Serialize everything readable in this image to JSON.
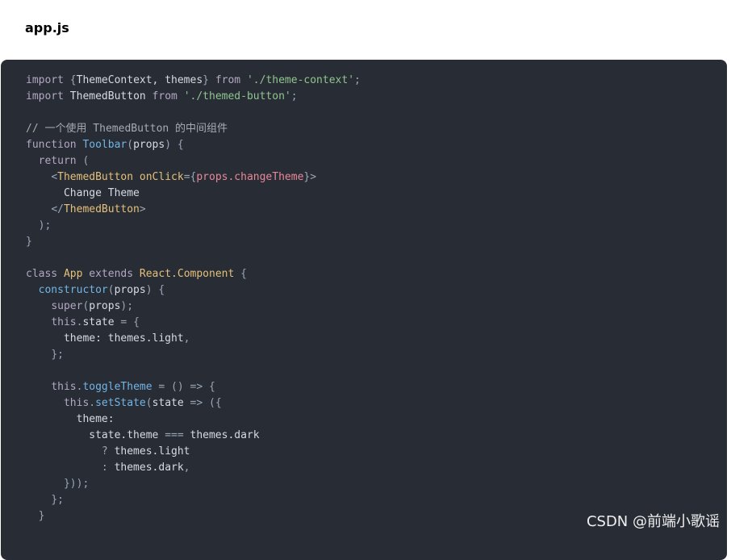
{
  "page": {
    "file_title": "app.js",
    "watermark": "CSDN @前端小歌谣"
  },
  "theme": {
    "code_background": "#282c34",
    "keyword_color": "#b3a8c4",
    "string_color": "#8fc58f",
    "comment_color": "#a6aab3",
    "function_color": "#72b5e6",
    "class_color": "#e5c07b",
    "jsx_expr_color": "#e8879a"
  },
  "code": {
    "language": "javascript",
    "lines": [
      [
        [
          "k",
          "import "
        ],
        [
          "p",
          "{"
        ],
        [
          "d",
          "ThemeContext, themes"
        ],
        [
          "p",
          "} "
        ],
        [
          "k",
          "from "
        ],
        [
          "s",
          "'./theme-context'"
        ],
        [
          "p",
          ";"
        ]
      ],
      [
        [
          "k",
          "import "
        ],
        [
          "d",
          "ThemedButton "
        ],
        [
          "k",
          "from "
        ],
        [
          "s",
          "'./themed-button'"
        ],
        [
          "p",
          ";"
        ]
      ],
      [],
      [
        [
          "c",
          "// 一个使用 ThemedButton 的中间组件"
        ]
      ],
      [
        [
          "k",
          "function "
        ],
        [
          "f",
          "Toolbar"
        ],
        [
          "p",
          "("
        ],
        [
          "d",
          "props"
        ],
        [
          "p",
          ") {"
        ]
      ],
      [
        [
          "d",
          "  "
        ],
        [
          "k",
          "return "
        ],
        [
          "p",
          "("
        ]
      ],
      [
        [
          "d",
          "    "
        ],
        [
          "p",
          "<"
        ],
        [
          "tag",
          "ThemedButton "
        ],
        [
          "attr",
          "onClick"
        ],
        [
          "p",
          "={"
        ],
        [
          "jsx",
          "props.changeTheme"
        ],
        [
          "p",
          "}>"
        ]
      ],
      [
        [
          "d",
          "      Change Theme"
        ]
      ],
      [
        [
          "d",
          "    "
        ],
        [
          "p",
          "</"
        ],
        [
          "tag",
          "ThemedButton"
        ],
        [
          "p",
          ">"
        ]
      ],
      [
        [
          "d",
          "  "
        ],
        [
          "p",
          ");"
        ]
      ],
      [
        [
          "p",
          "}"
        ]
      ],
      [],
      [
        [
          "k",
          "class "
        ],
        [
          "y",
          "App "
        ],
        [
          "k",
          "extends "
        ],
        [
          "y",
          "React.Component "
        ],
        [
          "p",
          "{"
        ]
      ],
      [
        [
          "d",
          "  "
        ],
        [
          "f",
          "constructor"
        ],
        [
          "p",
          "("
        ],
        [
          "d",
          "props"
        ],
        [
          "p",
          ") {"
        ]
      ],
      [
        [
          "d",
          "    "
        ],
        [
          "k",
          "super"
        ],
        [
          "p",
          "("
        ],
        [
          "d",
          "props"
        ],
        [
          "p",
          ");"
        ]
      ],
      [
        [
          "d",
          "    "
        ],
        [
          "k",
          "this"
        ],
        [
          "p",
          "."
        ],
        [
          "d",
          "state "
        ],
        [
          "p",
          "= {"
        ]
      ],
      [
        [
          "d",
          "      theme: themes.light"
        ],
        [
          "p",
          ","
        ]
      ],
      [
        [
          "d",
          "    "
        ],
        [
          "p",
          "};"
        ]
      ],
      [],
      [
        [
          "d",
          "    "
        ],
        [
          "k",
          "this"
        ],
        [
          "p",
          "."
        ],
        [
          "f",
          "toggleTheme "
        ],
        [
          "p",
          "= () => {"
        ]
      ],
      [
        [
          "d",
          "      "
        ],
        [
          "k",
          "this"
        ],
        [
          "p",
          "."
        ],
        [
          "f",
          "setState"
        ],
        [
          "p",
          "("
        ],
        [
          "d",
          "state "
        ],
        [
          "p",
          "=> ({"
        ]
      ],
      [
        [
          "d",
          "        theme:"
        ]
      ],
      [
        [
          "d",
          "          state.theme "
        ],
        [
          "p",
          "=== "
        ],
        [
          "d",
          "themes.dark"
        ]
      ],
      [
        [
          "d",
          "            "
        ],
        [
          "p",
          "? "
        ],
        [
          "d",
          "themes.light"
        ]
      ],
      [
        [
          "d",
          "            "
        ],
        [
          "p",
          ": "
        ],
        [
          "d",
          "themes.dark"
        ],
        [
          "p",
          ","
        ]
      ],
      [
        [
          "d",
          "      "
        ],
        [
          "p",
          "}));"
        ]
      ],
      [
        [
          "d",
          "    "
        ],
        [
          "p",
          "};"
        ]
      ],
      [
        [
          "d",
          "  "
        ],
        [
          "p",
          "}"
        ]
      ]
    ]
  }
}
